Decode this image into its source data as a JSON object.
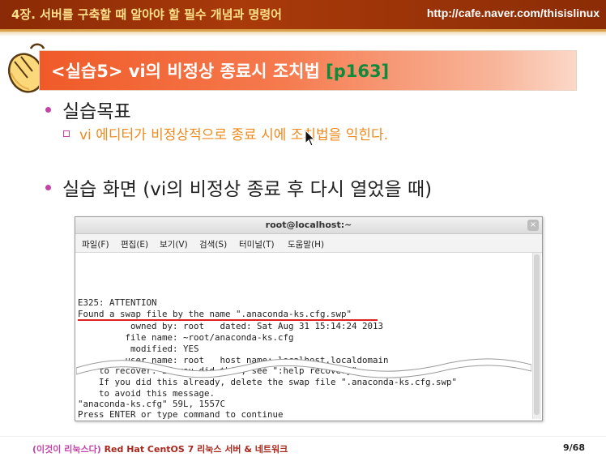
{
  "header": {
    "chapter": "4장. 서버를 구축할 때 알아야 할 필수 개념과 명령어",
    "url": "http://cafe.naver.com/thisislinux"
  },
  "slide": {
    "title_prefix": "<실습5> vi의 비정상 종료시 조치법 ",
    "title_page_ref": "[p163]",
    "bullet_goal": "실습목표",
    "bullet_goal_detail": "vi 에디터가 비정상적으로 종료 시에 조치법을 익힌다.",
    "bullet_screen": "실습 화면 (vi의 비정상 종료 후 다시 열었을 때)"
  },
  "terminal": {
    "window_title": "root@localhost:~",
    "close_label": "×",
    "menu": [
      "파일(F)",
      "편집(E)",
      "보기(V)",
      "검색(S)",
      "터미널(T)",
      "도움말(H)"
    ],
    "lines": [
      "E325: ATTENTION",
      "Found a swap file by the name \".anaconda-ks.cfg.swp\"",
      "          owned by: root   dated: Sat Aug 31 15:14:24 2013",
      "         file name: ~root/anaconda-ks.cfg",
      "          modified: YES",
      "         user name: root   host name: localhost.localdomain",
      "    to recover. If you did this, see \":help recovery\".",
      "    If you did this already, delete the swap file \".anaconda-ks.cfg.swp\"",
      "    to avoid this message.",
      "\"anaconda-ks.cfg\" 59L, 1557C",
      "Press ENTER or type command to continue"
    ]
  },
  "footer": {
    "book": "(이것이 리눅스다)",
    "series": " Red Hat CentOS 7 리눅스 서버 & 네트워크",
    "page": "9/68"
  },
  "colors": {
    "header_bg": "#a93a0a",
    "title_orange": "#f05a28",
    "title_page_ref": "#0d8a3a",
    "detail_orange": "#ee8a1e",
    "bullet_magenta": "#c244a8"
  }
}
